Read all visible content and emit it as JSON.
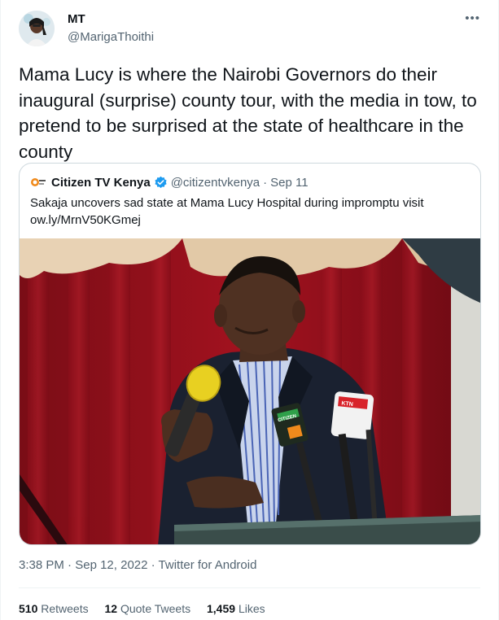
{
  "author": {
    "name": "MT",
    "handle": "@MarigaThoithi"
  },
  "tweet": {
    "text": "Mama Lucy is where the Nairobi Governors do their inaugural (surprise) county tour, with the media in tow, to pretend to be surprised at the state of healthcare in the county"
  },
  "quoted": {
    "name": "Citizen TV Kenya",
    "handle": "@citizentvkenya",
    "separator": "·",
    "date": "Sep 11",
    "text_line1": "Sakaja uncovers sad state at Mama Lucy Hospital during impromptu visit",
    "text_line2": "ow.ly/MrnV50KGmej",
    "mic_label_1": "CITIZEN",
    "mic_label_2": "KTN"
  },
  "meta": {
    "time": "3:38 PM",
    "separator": "·",
    "date": "Sep 12, 2022",
    "source": "Twitter for Android"
  },
  "stats": {
    "retweets_count": "510",
    "retweets_label": "Retweets",
    "quotes_count": "12",
    "quotes_label": "Quote Tweets",
    "likes_count": "1,459",
    "likes_label": "Likes"
  },
  "colors": {
    "text": "#0f1419",
    "secondary": "#536471",
    "border": "#cfd9de",
    "verified": "#1d9bf0"
  }
}
